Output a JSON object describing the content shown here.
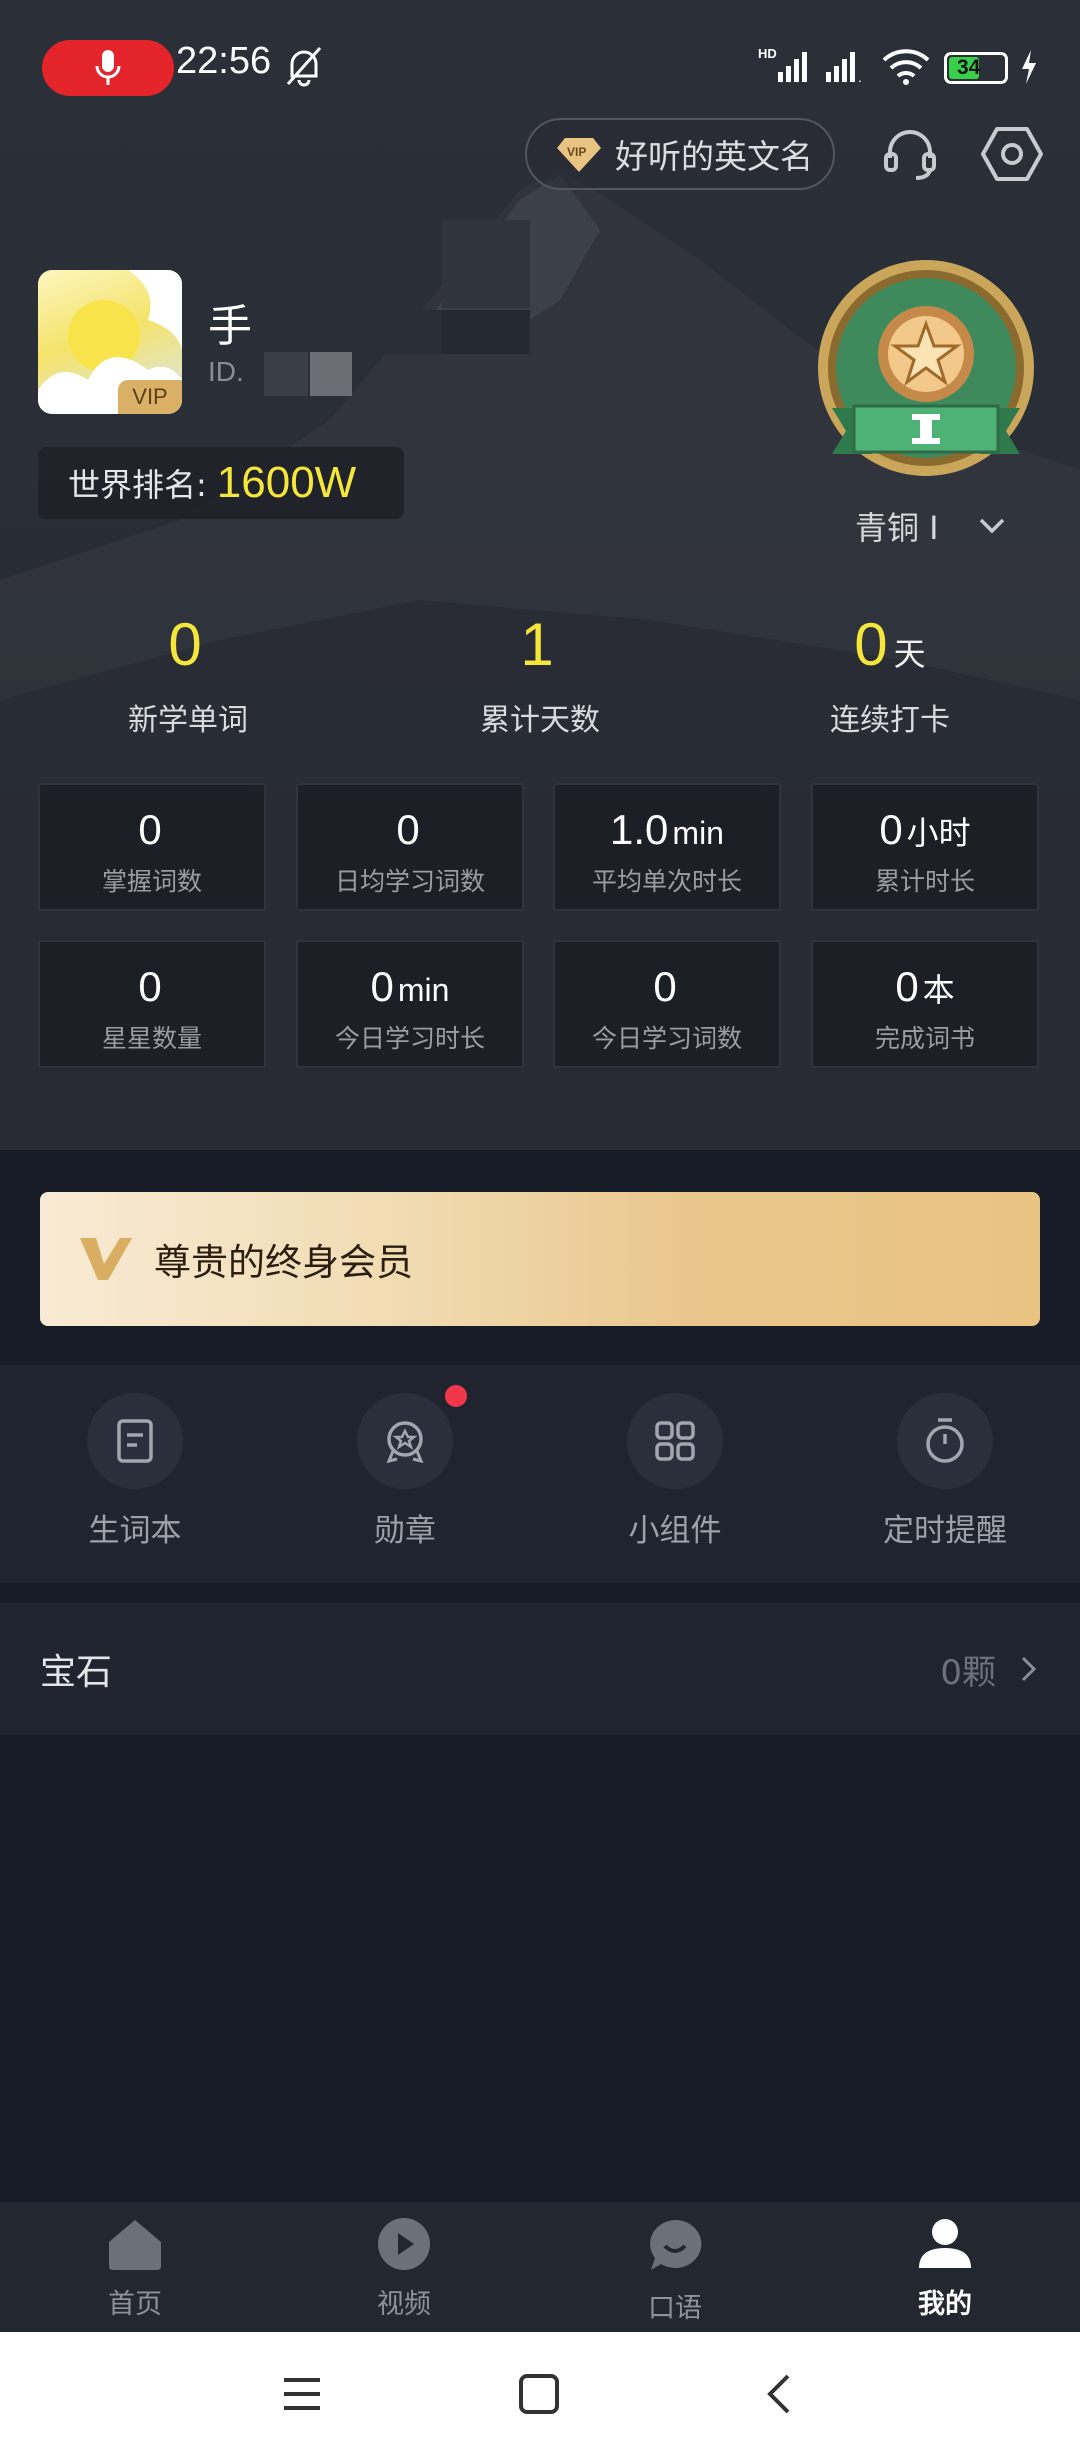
{
  "status_bar": {
    "time": "22:56",
    "battery": "34"
  },
  "header": {
    "vip_name_button": "好听的英文名"
  },
  "profile": {
    "name": "手",
    "id_label": "ID.",
    "avatar_tag": "VIP",
    "rank_label": "世界排名:",
    "rank_value": "1600W",
    "level": "青铜 I"
  },
  "stats": [
    {
      "value": "0",
      "unit": "",
      "label": "新学单词"
    },
    {
      "value": "1",
      "unit": "",
      "label": "累计天数"
    },
    {
      "value": "0",
      "unit": "天",
      "label": "连续打卡"
    }
  ],
  "grid": [
    {
      "value": "0",
      "unit": "",
      "label": "掌握词数"
    },
    {
      "value": "0",
      "unit": "",
      "label": "日均学习词数"
    },
    {
      "value": "1.0",
      "unit": "min",
      "label": "平均单次时长"
    },
    {
      "value": "0",
      "unit": "小时",
      "label": "累计时长"
    },
    {
      "value": "0",
      "unit": "",
      "label": "星星数量"
    },
    {
      "value": "0",
      "unit": "min",
      "label": "今日学习时长"
    },
    {
      "value": "0",
      "unit": "",
      "label": "今日学习词数"
    },
    {
      "value": "0",
      "unit": "本",
      "label": "完成词书"
    }
  ],
  "member_banner": {
    "text": "尊贵的终身会员"
  },
  "functions": [
    {
      "label": "生词本",
      "icon": "notebook-icon"
    },
    {
      "label": "勋章",
      "icon": "medal-icon"
    },
    {
      "label": "小组件",
      "icon": "widgets-icon"
    },
    {
      "label": "定时提醒",
      "icon": "timer-icon"
    }
  ],
  "gems": {
    "label": "宝石",
    "value": "0颗"
  },
  "tabs": [
    {
      "label": "首页",
      "icon": "home-icon"
    },
    {
      "label": "视频",
      "icon": "video-icon"
    },
    {
      "label": "口语",
      "icon": "speech-icon"
    },
    {
      "label": "我的",
      "icon": "profile-icon",
      "active": true
    }
  ],
  "colors": {
    "accent_yellow": "#f5e63c",
    "red_dot": "#f0364a",
    "gold": "#e9c382"
  }
}
